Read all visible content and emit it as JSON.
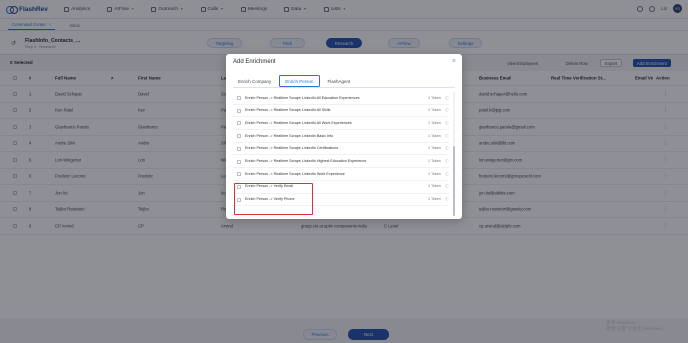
{
  "app": {
    "name": "FlashRev"
  },
  "nav": {
    "items": [
      {
        "label": "Analytics",
        "icon": "chart-icon"
      },
      {
        "label": "AIFlow",
        "icon": "flow-icon"
      },
      {
        "label": "Outreach",
        "icon": "send-icon"
      },
      {
        "label": "Calls",
        "icon": "phone-icon"
      },
      {
        "label": "Meetings",
        "icon": "calendar-icon"
      },
      {
        "label": "Data",
        "icon": "database-icon"
      },
      {
        "label": "Lists",
        "icon": "list-icon"
      }
    ],
    "user": "Liz",
    "avatar": "YO"
  },
  "subtabs": [
    {
      "label": "Command Center"
    },
    {
      "label": "Inbox"
    }
  ],
  "file": {
    "name": "FlashInfo_Contacts_...",
    "subtitle": "Step 3 · Research"
  },
  "steps": [
    {
      "label": "Targeting"
    },
    {
      "label": "Pitch"
    },
    {
      "label": "Research"
    },
    {
      "label": "AIFlow"
    },
    {
      "label": "Settings"
    }
  ],
  "toolbar": {
    "selected": "0 Selected",
    "view_employees": "View Employees",
    "delete_row": "Delete Row",
    "export": "Export",
    "add_enrichment": "Add Enrichment"
  },
  "table": {
    "headers": [
      "#",
      "Full Name",
      "First Name",
      "La",
      "Business Email",
      "Real Time Verification St...",
      "Email Ve",
      "Action"
    ],
    "rows": [
      {
        "num": "1",
        "full": "David Schaper",
        "first": "David",
        "last": "Sch",
        "email": "david.schaper@hello.com",
        "extra": ""
      },
      {
        "num": "2",
        "full": "Ken Patel",
        "first": "Ken",
        "last": "Pat",
        "email": "patel.k@jpg.com",
        "extra": ""
      },
      {
        "num": "3",
        "full": "Gianfranco Parola",
        "first": "Gianfranco",
        "last": "Par",
        "email": "gianfranco.parola@gmail.com",
        "extra": ""
      },
      {
        "num": "4",
        "full": "Andre Silvi",
        "first": "Andre",
        "last": "Silv",
        "email": "andre.silvi@ibl.com",
        "extra": ""
      },
      {
        "num": "5",
        "full": "Lori Wingerter",
        "first": "Lori",
        "last": "Win",
        "email": "lori.wingerter@gm.com",
        "extra": ""
      },
      {
        "num": "6",
        "full": "Frederic Lecorre",
        "first": "Frederic",
        "last": "Lec",
        "email": "frederic.lecorre@groupeseril.com",
        "extra": ""
      },
      {
        "num": "7",
        "full": "Jun Ito",
        "first": "Jun",
        "last": "Ito",
        "email": "jun.ito@abbits.com",
        "extra": ""
      },
      {
        "num": "8",
        "full": "Teijbo Rossinori",
        "first": "Teijbo",
        "last": "Ros",
        "email": "teijbo.rossinori@gravity.com",
        "extra": ""
      },
      {
        "num": "9",
        "full": "CP Arvind",
        "first": "CP",
        "last": "Arvind",
        "email": "cp.arvind@delphi.com",
        "extra": "group.cio at aptiv components india",
        "extra2": "C Level"
      }
    ]
  },
  "pagination": {
    "prev": "Previous",
    "next": "Next"
  },
  "watermark": {
    "line1": "激活 Windows",
    "line2": "转到\"设置\"以激活 Windows。"
  },
  "modal": {
    "title": "Add Enrichment",
    "tabs": [
      {
        "label": "Enrich Company"
      },
      {
        "label": "Enrich Person"
      },
      {
        "label": "FlashAgent"
      }
    ],
    "items": [
      {
        "label": "Enrich Person -> Realtime Scrape LinkedIn All Education Experiences",
        "tokens": "1 Token"
      },
      {
        "label": "Enrich Person -> Realtime Scrape LinkedIn All Skills",
        "tokens": "1 Token"
      },
      {
        "label": "Enrich Person -> Realtime Scrape LinkedIn All Work Experiences",
        "tokens": "1 Token"
      },
      {
        "label": "Enrich Person -> Realtime Scrape LinkedIn Basic Info",
        "tokens": "1 Token"
      },
      {
        "label": "Enrich Person -> Realtime Scrape LinkedIn Certifications",
        "tokens": "1 Token"
      },
      {
        "label": "Enrich Person -> Realtime Scrape LinkedIn Highest Education Experience",
        "tokens": "1 Token"
      },
      {
        "label": "Enrich Person -> Realtime Scrape LinkedIn Work Experience",
        "tokens": "1 Token"
      },
      {
        "label": "Enrich Person -> Verify Email",
        "tokens": "1 Token"
      },
      {
        "label": "Enrich Person -> Verify Phone",
        "tokens": "1 Token"
      }
    ],
    "highlight_color": "#d9313a"
  },
  "colors": {
    "brand": "#1f4fae",
    "accent": "#2f6fdc"
  }
}
